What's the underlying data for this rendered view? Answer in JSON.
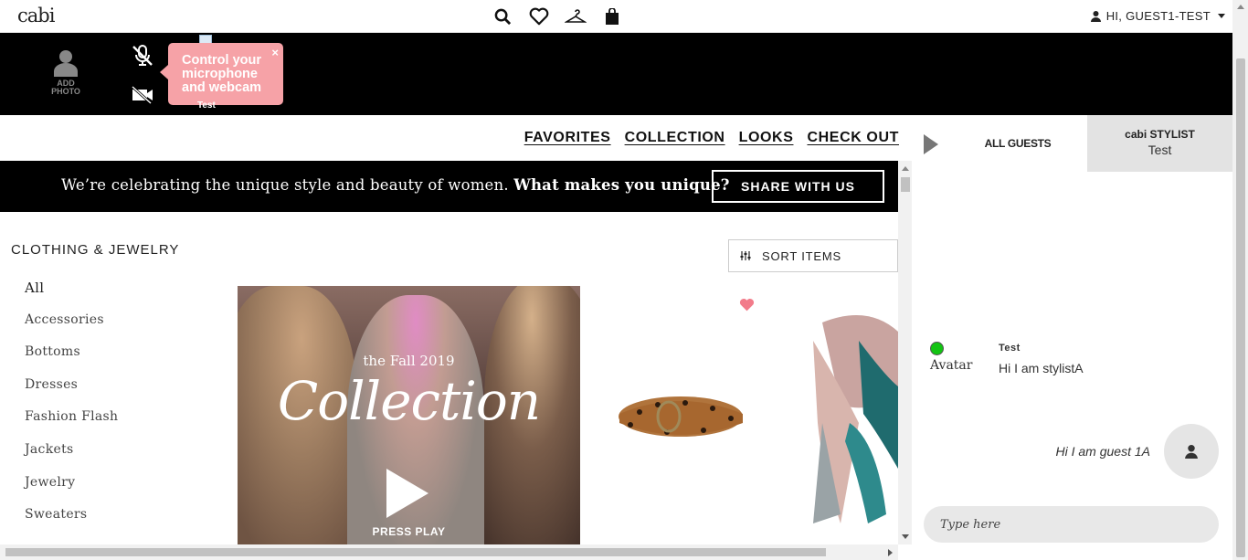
{
  "header": {
    "logo": "cabi",
    "user_label": "HI, GUEST1-TEST"
  },
  "video": {
    "add_photo_line1": "ADD",
    "add_photo_line2": "PHOTO",
    "tooltip": "Control your microphone and webcam",
    "tooltip_close": "×",
    "participant_name": "Test"
  },
  "nav": {
    "favorites": "FAVORITES",
    "collection": "COLLECTION",
    "looks": "LOOKS",
    "checkout": "CHECK OUT"
  },
  "banner": {
    "text": "We’re celebrating the unique style and beauty of women.",
    "bold": "What makes you unique?",
    "button": "SHARE WITH US"
  },
  "catalog": {
    "section_title": "CLOTHING & JEWELRY",
    "sort_label": "SORT ITEMS",
    "categories": [
      "All",
      "Accessories",
      "Bottoms",
      "Dresses",
      "Fashion Flash",
      "Jackets",
      "Jewelry",
      "Sweaters"
    ],
    "hero_sub": "the Fall 2019",
    "hero_title": "Collection",
    "hero_cta": "PRESS PLAY"
  },
  "chat": {
    "tab_all": "ALL GUESTS",
    "tab_stylist_title": "cabi STYLIST",
    "tab_stylist_name": "Test",
    "msg1_avatar_alt": "Avatar",
    "msg1_name": "Test",
    "msg1_text": "Hi I am stylistA",
    "msg2_text": "Hi I am guest 1A",
    "input_placeholder": "Type here"
  },
  "colors": {
    "tooltip": "#f6a2a7",
    "online": "#12c412",
    "heart": "#f27b8a"
  }
}
